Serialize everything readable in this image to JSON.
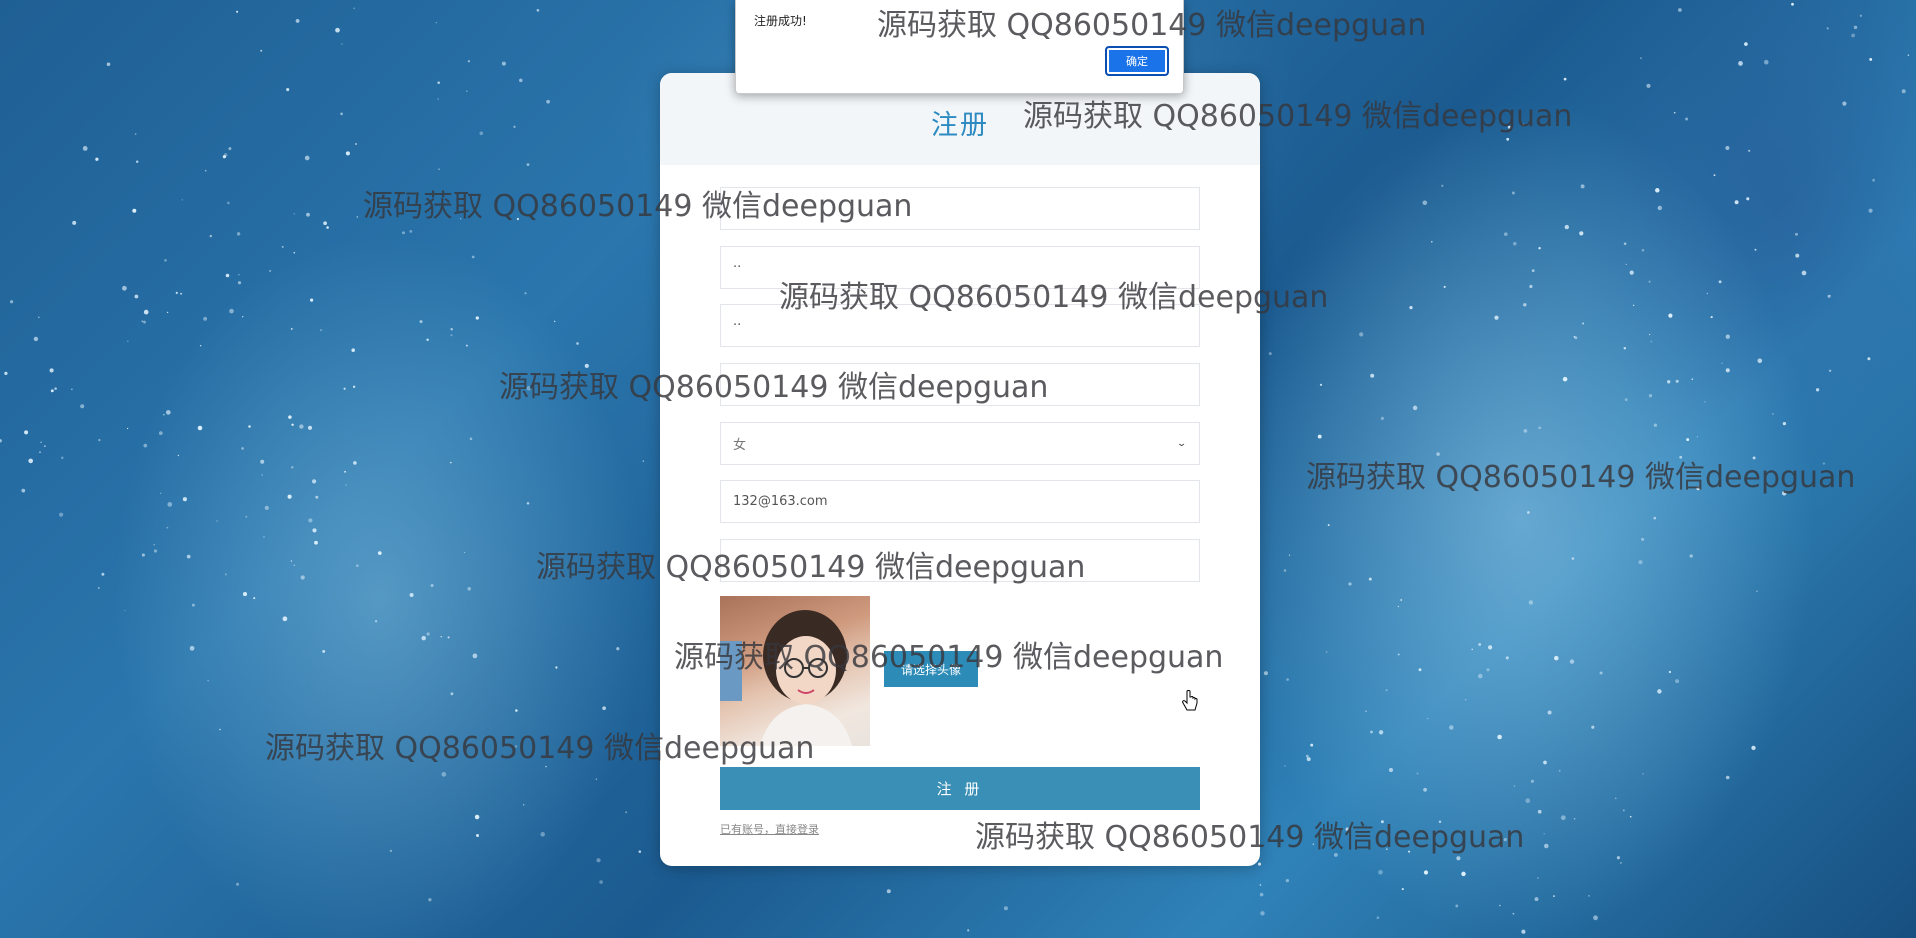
{
  "alert": {
    "message": "注册成功!",
    "ok_label": "确定"
  },
  "form": {
    "title": "注册",
    "fields": [
      {
        "value": "",
        "placeholder": ""
      },
      {
        "value": "··",
        "placeholder": ""
      },
      {
        "value": "··",
        "placeholder": ""
      },
      {
        "value": "",
        "placeholder": ""
      },
      {
        "value": "女",
        "placeholder": ""
      },
      {
        "value": "132@163.com",
        "placeholder": ""
      },
      {
        "value": "",
        "placeholder": ""
      }
    ],
    "choose_avatar_label": "请选择头像",
    "submit_label": "注 册",
    "login_link": "已有账号，直接登录"
  },
  "watermark": "源码获取 QQ86050149 微信deepguan",
  "colors": {
    "accent": "#2d8bc2",
    "button": "#3a8fb6",
    "alert_ok": "#1a73e8"
  }
}
